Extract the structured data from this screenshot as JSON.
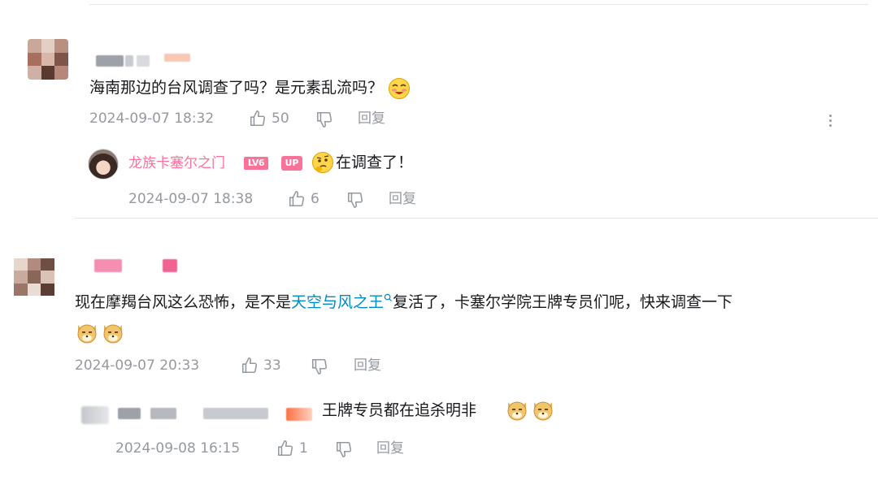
{
  "comments": [
    {
      "text": "海南那边的台风调查了吗？是元素乱流吗？",
      "date": "2024-09-07 18:32",
      "likes": "50",
      "reply_label": "回复",
      "replies": [
        {
          "username": "龙族卡塞尔之门",
          "level": "LV6",
          "up_badge": "UP",
          "text": "在调查了！",
          "date": "2024-09-07 18:38",
          "likes": "6",
          "reply_label": "回复"
        }
      ]
    },
    {
      "text_before": "现在摩羯台风这么恐怖，是不是",
      "link": "天空与风之王",
      "text_after": "复活了，卡塞尔学院王牌专员们呢，快来调查一下",
      "date": "2024-09-07 20:33",
      "likes": "33",
      "reply_label": "回复",
      "replies": [
        {
          "text": "王牌专员都在追杀明非",
          "date": "2024-09-08 16:15",
          "likes": "1",
          "reply_label": "回复"
        }
      ]
    }
  ],
  "colors": {
    "accent": "#fb7299",
    "link": "#008ac5",
    "meta": "#9499a0",
    "divider": "#e3e5e7"
  }
}
